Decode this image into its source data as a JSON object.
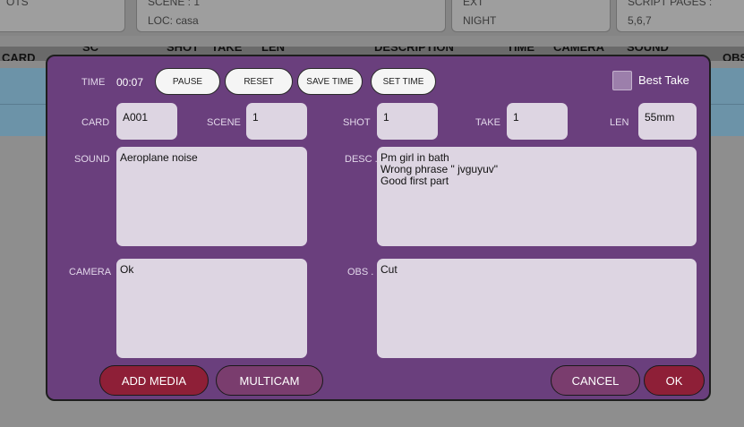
{
  "header": {
    "cell1": {
      "line1": "OTS"
    },
    "cell2": {
      "line1": "SCENE : 1",
      "line2": "LOC: casa"
    },
    "cell3": {
      "line1": "EXT",
      "line2": "NIGHT"
    },
    "cell4": {
      "line1": "SCRIPT PAGES :",
      "line2": "5,6,7"
    }
  },
  "columns": [
    "CARD",
    "SC",
    "SHOT",
    "TAKE",
    "LEN",
    "DESCRIPTION",
    "TIME",
    "CAMERA",
    "SOUND",
    "OBS"
  ],
  "dialog": {
    "time_label": "TIME",
    "time_value": "00:07",
    "pause_label": "PAUSE",
    "reset_label": "RESET",
    "save_time_label": "SAVE TIME",
    "set_time_label": "SET TIME",
    "best_take_label": "Best Take",
    "best_take_checked": false,
    "card_label": "CARD",
    "card_value": "A001",
    "scene_label": "SCENE",
    "scene_value": "1",
    "shot_label": "SHOT",
    "shot_value": "1",
    "take_label": "TAKE",
    "take_value": "1",
    "len_label": "LEN",
    "len_value": "55mm",
    "sound_label": "SOUND",
    "sound_value": "Aeroplane noise",
    "desc_label": "DESC .",
    "desc_value": "Pm girl in bath\nWrong phrase \" jvguyuv\"\nGood first part",
    "camera_label": "CAMERA",
    "camera_value": "Ok",
    "obs_label": "OBS .",
    "obs_value": "Cut",
    "add_media_label": "ADD MEDIA",
    "multicam_label": "MULTICAM",
    "cancel_label": "CANCEL",
    "ok_label": "OK"
  },
  "colors": {
    "dialog_bg": "#6a3f7d",
    "field_bg": "#ddd5e2",
    "red_button": "#8e1f37",
    "purple_button": "#7a3d6e",
    "row_blue": "#6c93a8"
  }
}
